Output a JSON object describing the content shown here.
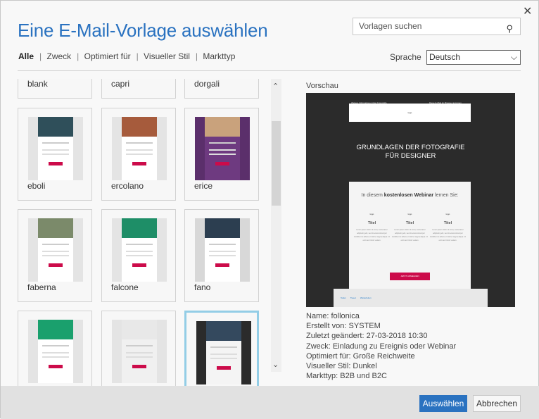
{
  "dialog": {
    "title": "Eine E-Mail-Vorlage auswählen",
    "close_icon": "close-icon"
  },
  "search": {
    "placeholder": "Vorlagen suchen",
    "icon": "search-icon"
  },
  "filters": [
    "Alle",
    "Zweck",
    "Optimiert für",
    "Visueller Stil",
    "Markttyp"
  ],
  "language": {
    "label": "Sprache",
    "value": "Deutsch"
  },
  "templates": [
    {
      "name": "blank"
    },
    {
      "name": "capri"
    },
    {
      "name": "dorgali"
    },
    {
      "name": "eboli"
    },
    {
      "name": "ercolano"
    },
    {
      "name": "erice"
    },
    {
      "name": "faberna"
    },
    {
      "name": "falcone"
    },
    {
      "name": "fano"
    },
    {
      "name": ""
    },
    {
      "name": ""
    },
    {
      "name": "follonica",
      "selected": true
    }
  ],
  "preview": {
    "label": "Vorschau",
    "top_left": "Weitere Informationen über Fotografie",
    "top_right": "Diese E-Mail im Browser anzeigen",
    "logo": "logo",
    "hero_line1": "GRUNDLAGEN DER FOTOGRAFIE",
    "hero_line2": "FÜR DESIGNER",
    "intro_pre": "In diesem ",
    "intro_bold": "kostenlosen Webinar",
    "intro_post": " lernen Sie:",
    "col_title": "Titel",
    "col_text": "Lorem ipsum dolor sit amet, consectetur adipiscing elit, sed do eiusmod tempor incididunt ut labore et dolore magna aliqua. Ut enim ad minim veniam.",
    "cta": "JETZT ANMELDEN",
    "footer": [
      "Teilen",
      "Tweet",
      "Weiterleiten"
    ]
  },
  "info": {
    "name": "Name: follonica",
    "created_by": "Erstellt von: SYSTEM",
    "modified": "Zuletzt geändert: 27-03-2018 10:30",
    "purpose": "Zweck: Einladung zu Ereignis oder Webinar",
    "optimized": "Optimiert für: Große Reichweite",
    "style": "Visueller Stil: Dunkel",
    "market": "Markttyp: B2B und B2C"
  },
  "buttons": {
    "select": "Auswählen",
    "cancel": "Abbrechen"
  },
  "colors": {
    "accent": "#2a72c0",
    "selected_border": "#93cde6",
    "cta": "#cc0b4a"
  }
}
